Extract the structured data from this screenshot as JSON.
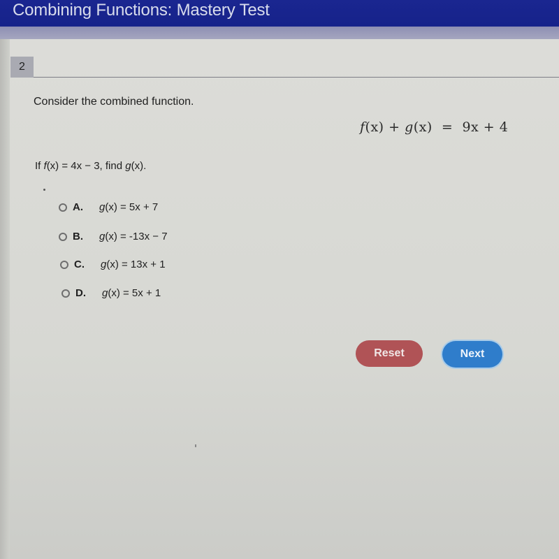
{
  "header": {
    "title": "Combining Functions: Mastery Test"
  },
  "question": {
    "number": "2",
    "prompt": "Consider the combined function.",
    "equation": {
      "lhs_f": "f",
      "lhs_f_arg": "(x)",
      "plus": "+",
      "lhs_g": "g",
      "lhs_g_arg": "(x)",
      "equals": "=",
      "rhs": "9x + 4"
    },
    "text_prefix": "If ",
    "text_f": "f",
    "text_mid": "(x) = 4x − 3, find ",
    "text_g": "g",
    "text_suffix": "(x)."
  },
  "options": [
    {
      "letter": "A.",
      "fn": "g",
      "rest": "(x) = 5x + 7",
      "selected": false
    },
    {
      "letter": "B.",
      "fn": "g",
      "rest": "(x) = -13x − 7",
      "selected": false
    },
    {
      "letter": "C.",
      "fn": "g",
      "rest": "(x) = 13x + 1",
      "selected": false
    },
    {
      "letter": "D.",
      "fn": "g",
      "rest": "(x) = 5x + 1",
      "selected": false
    }
  ],
  "buttons": {
    "reset_label": "Reset",
    "next_label": "Next"
  },
  "colors": {
    "header_bg": "#1a2690",
    "reset_bg": "#b05356",
    "next_bg": "#2f7dcb"
  }
}
